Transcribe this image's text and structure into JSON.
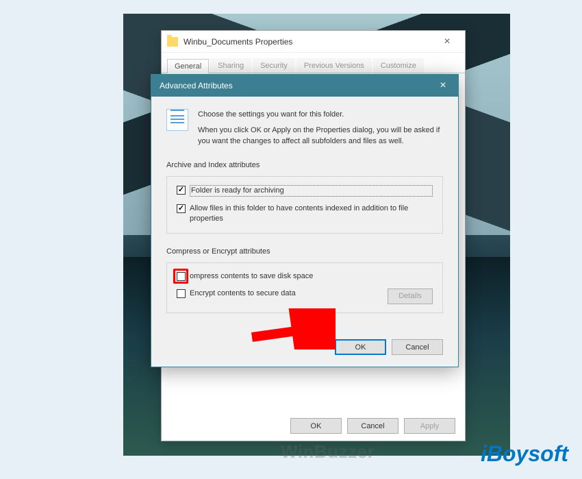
{
  "properties": {
    "title": "Winbu_Documents Properties",
    "tabs": [
      "General",
      "Sharing",
      "Security",
      "Previous Versions",
      "Customize"
    ],
    "buttons": {
      "ok": "OK",
      "cancel": "Cancel",
      "apply": "Apply"
    }
  },
  "advanced": {
    "title": "Advanced Attributes",
    "intro1": "Choose the settings you want for this folder.",
    "intro2": "When you click OK or Apply on the Properties dialog, you will be asked if you want the changes to affect all subfolders and files as well.",
    "group_archive_label": "Archive and Index attributes",
    "archive_ready": {
      "label": "Folder is ready for archiving",
      "checked": true
    },
    "index_files": {
      "label": "Allow files in this folder to have contents indexed in addition to file properties",
      "checked": true
    },
    "group_compress_label": "Compress or Encrypt attributes",
    "compress": {
      "label": "ompress contents to save disk space",
      "checked": false
    },
    "encrypt": {
      "label": "Encrypt contents to secure data",
      "checked": false
    },
    "details_btn": "Details",
    "buttons": {
      "ok": "OK",
      "cancel": "Cancel"
    }
  },
  "watermark": {
    "winbuzzer": "WinBuzzer",
    "iboysoft": "iBoysoft"
  }
}
